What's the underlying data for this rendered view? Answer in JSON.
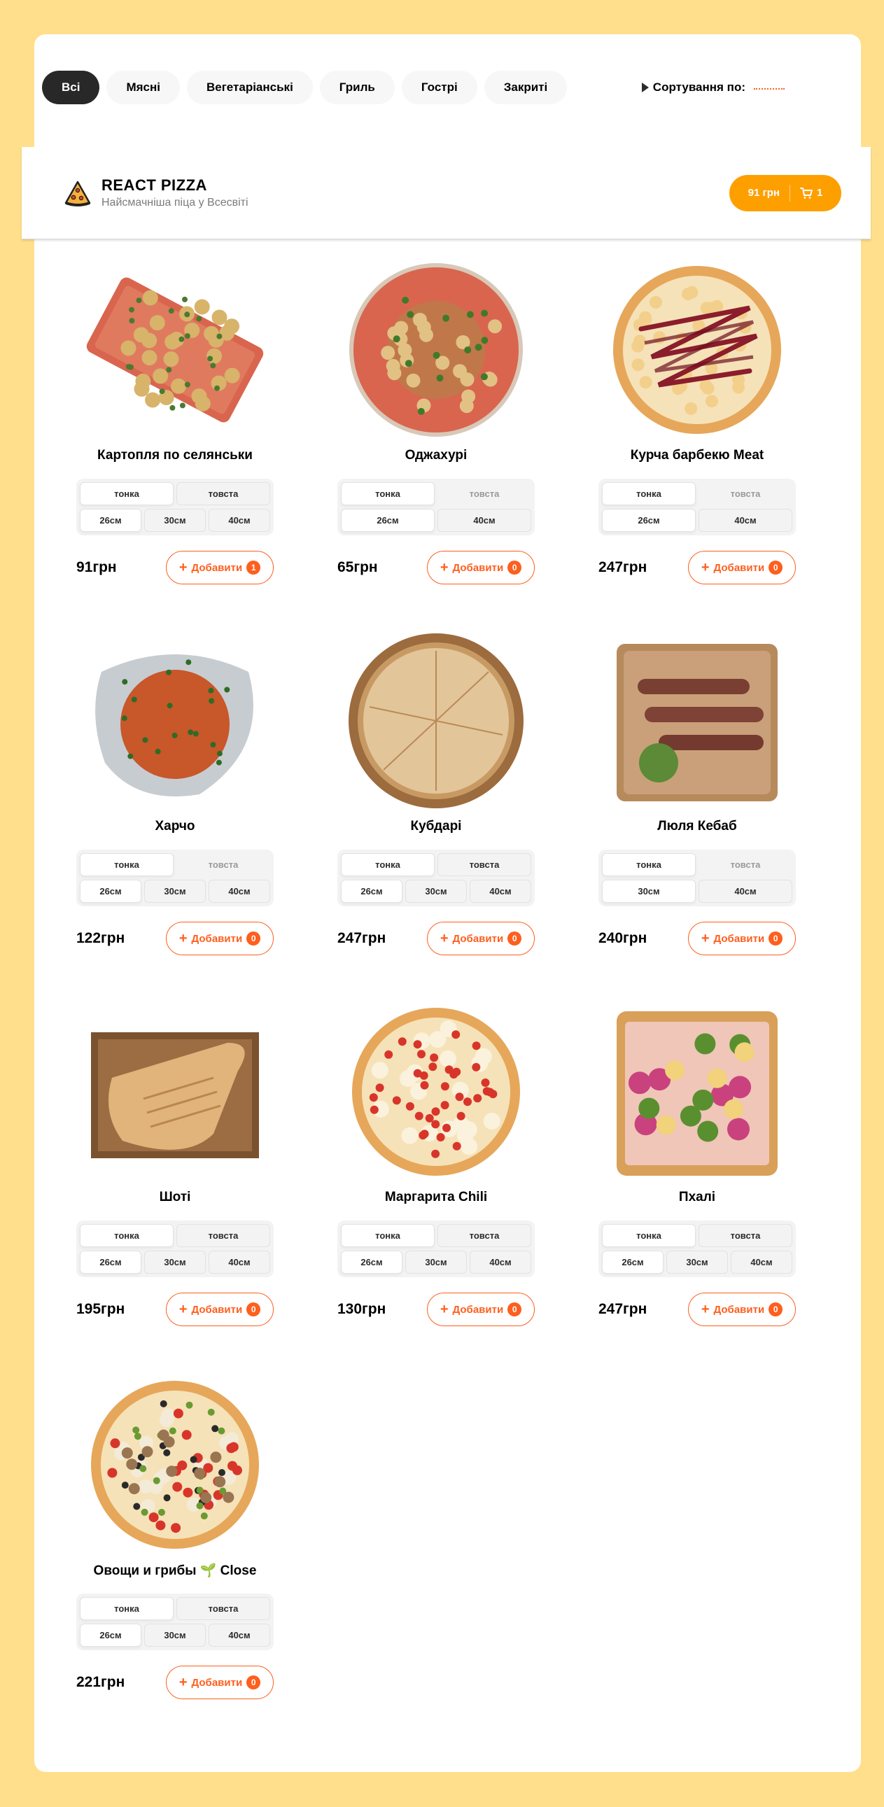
{
  "categories": [
    "Всі",
    "Мясні",
    "Вегетаріанські",
    "Гриль",
    "Гострі",
    "Закриті"
  ],
  "active_category": 0,
  "sort": {
    "label": "Сортування по:"
  },
  "header": {
    "title": "REACT PIZZA",
    "subtitle": "Найсмачніша піца у Всесвіті",
    "cart_total": "91 грн",
    "cart_count": "1"
  },
  "colors": {
    "accent": "#fe5f1e",
    "cart": "#fe9f00",
    "background": "#ffdf8c"
  },
  "products": [
    {
      "title": "Картопля по селянськи",
      "image_icon": "potato-dish-icon",
      "types": [
        {
          "label": "тонка",
          "state": "active"
        },
        {
          "label": "товста",
          "state": "normal"
        }
      ],
      "sizes": [
        {
          "label": "26см",
          "state": "active"
        },
        {
          "label": "30см",
          "state": "normal"
        },
        {
          "label": "40см",
          "state": "normal"
        }
      ],
      "price": "91грн",
      "add_label": "Добавити",
      "count": "1"
    },
    {
      "title": "Оджахурі",
      "image_icon": "ojakhuri-plate-icon",
      "types": [
        {
          "label": "тонка",
          "state": "active"
        },
        {
          "label": "товста",
          "state": "disabled"
        }
      ],
      "sizes": [
        {
          "label": "26см",
          "state": "active"
        },
        {
          "label": "40см",
          "state": "normal"
        }
      ],
      "price": "65грн",
      "add_label": "Добавити",
      "count": "0"
    },
    {
      "title": "Курча барбекю Meat",
      "image_icon": "bbq-pizza-icon",
      "types": [
        {
          "label": "тонка",
          "state": "active"
        },
        {
          "label": "товста",
          "state": "disabled"
        }
      ],
      "sizes": [
        {
          "label": "26см",
          "state": "active"
        },
        {
          "label": "40см",
          "state": "normal"
        }
      ],
      "price": "247грн",
      "add_label": "Добавити",
      "count": "0"
    },
    {
      "title": "Харчо",
      "image_icon": "kharcho-soup-icon",
      "types": [
        {
          "label": "тонка",
          "state": "active"
        },
        {
          "label": "товста",
          "state": "disabled"
        }
      ],
      "sizes": [
        {
          "label": "26см",
          "state": "active"
        },
        {
          "label": "30см",
          "state": "normal"
        },
        {
          "label": "40см",
          "state": "normal"
        }
      ],
      "price": "122грн",
      "add_label": "Добавити",
      "count": "0"
    },
    {
      "title": "Кубдарі",
      "image_icon": "kubdari-pie-icon",
      "types": [
        {
          "label": "тонка",
          "state": "active"
        },
        {
          "label": "товста",
          "state": "normal"
        }
      ],
      "sizes": [
        {
          "label": "26см",
          "state": "active"
        },
        {
          "label": "30см",
          "state": "normal"
        },
        {
          "label": "40см",
          "state": "normal"
        }
      ],
      "price": "247грн",
      "add_label": "Добавити",
      "count": "0"
    },
    {
      "title": "Люля Кебаб",
      "image_icon": "kebab-board-icon",
      "types": [
        {
          "label": "тонка",
          "state": "active"
        },
        {
          "label": "товста",
          "state": "disabled"
        }
      ],
      "sizes": [
        {
          "label": "30см",
          "state": "active"
        },
        {
          "label": "40см",
          "state": "normal"
        }
      ],
      "price": "240грн",
      "add_label": "Добавити",
      "count": "0"
    },
    {
      "title": "Шоті",
      "image_icon": "shoti-bread-icon",
      "types": [
        {
          "label": "тонка",
          "state": "active"
        },
        {
          "label": "товста",
          "state": "normal"
        }
      ],
      "sizes": [
        {
          "label": "26см",
          "state": "active"
        },
        {
          "label": "30см",
          "state": "normal"
        },
        {
          "label": "40см",
          "state": "normal"
        }
      ],
      "price": "195грн",
      "add_label": "Добавити",
      "count": "0"
    },
    {
      "title": "Маргарита Chili",
      "image_icon": "margherita-pizza-icon",
      "types": [
        {
          "label": "тонка",
          "state": "active"
        },
        {
          "label": "товста",
          "state": "normal"
        }
      ],
      "sizes": [
        {
          "label": "26см",
          "state": "active"
        },
        {
          "label": "30см",
          "state": "normal"
        },
        {
          "label": "40см",
          "state": "normal"
        }
      ],
      "price": "130грн",
      "add_label": "Добавити",
      "count": "0"
    },
    {
      "title": "Пхалі",
      "image_icon": "pkhali-board-icon",
      "types": [
        {
          "label": "тонка",
          "state": "active"
        },
        {
          "label": "товста",
          "state": "normal"
        }
      ],
      "sizes": [
        {
          "label": "26см",
          "state": "active"
        },
        {
          "label": "30см",
          "state": "normal"
        },
        {
          "label": "40см",
          "state": "normal"
        }
      ],
      "price": "247грн",
      "add_label": "Добавити",
      "count": "0"
    },
    {
      "title": "Овощи и грибы 🌱 Close",
      "image_icon": "veggie-pizza-icon",
      "types": [
        {
          "label": "тонка",
          "state": "active"
        },
        {
          "label": "товста",
          "state": "normal"
        }
      ],
      "sizes": [
        {
          "label": "26см",
          "state": "active"
        },
        {
          "label": "30см",
          "state": "normal"
        },
        {
          "label": "40см",
          "state": "normal"
        }
      ],
      "price": "221грн",
      "add_label": "Добавити",
      "count": "0"
    }
  ]
}
